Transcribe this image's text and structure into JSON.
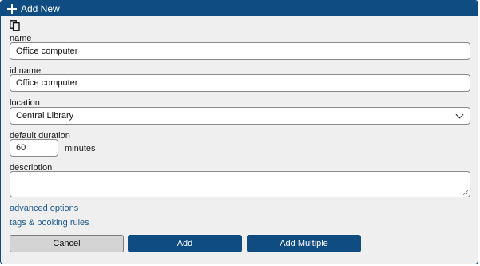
{
  "dialog": {
    "title": "Add New"
  },
  "fields": {
    "name": {
      "label": "name",
      "value": "Office computer"
    },
    "id_name": {
      "label": "id name",
      "value": "Office computer"
    },
    "location": {
      "label": "location",
      "value": "Central Library"
    },
    "default_duration": {
      "label": "default duration",
      "value": "60",
      "unit": "minutes"
    },
    "description": {
      "label": "description",
      "value": ""
    }
  },
  "links": {
    "advanced_options": "advanced options",
    "tags_booking_rules": "tags & booking rules"
  },
  "buttons": {
    "cancel": "Cancel",
    "add": "Add",
    "add_multiple": "Add Multiple"
  },
  "icons": {
    "title": "plus-icon",
    "copy": "copy-icon",
    "select": "chevron-down-icon"
  },
  "colors": {
    "accent": "#0f4c81",
    "link": "#1d5a8f",
    "background": "#efefef"
  }
}
